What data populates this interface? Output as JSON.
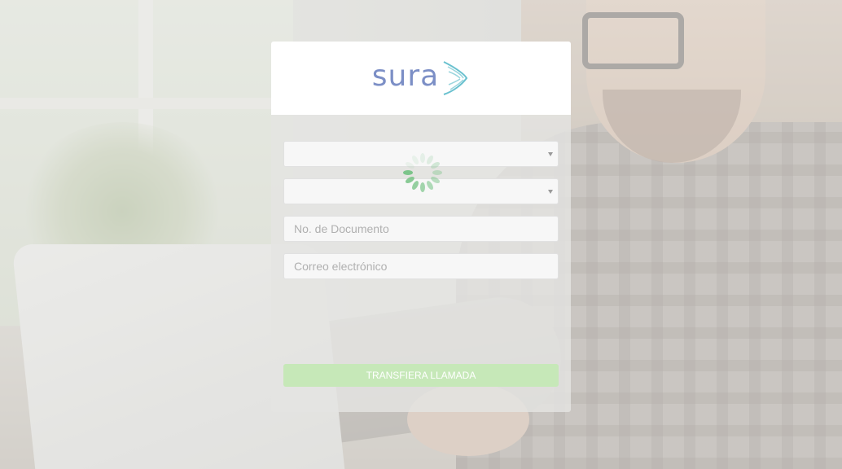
{
  "brand": {
    "logo_text": "sura",
    "logo_color": "#7c8fc6",
    "logo_accent": "#6ac1cf"
  },
  "form": {
    "select1": {
      "value": ""
    },
    "select2": {
      "value": ""
    },
    "document_input": {
      "placeholder": "No. de Documento",
      "value": ""
    },
    "email_input": {
      "placeholder": "Correo electrónico",
      "value": ""
    },
    "submit_label": "TRANSFIERA LLAMADA"
  },
  "status": {
    "loading": true,
    "spinner_color": "#7cc48a"
  },
  "colors": {
    "button_bg": "#c6e8b8",
    "card_header_bg": "#ffffff"
  }
}
